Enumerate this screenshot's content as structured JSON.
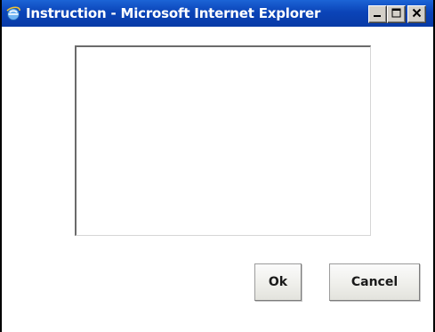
{
  "window": {
    "title": "Instruction - Microsoft Internet Explorer",
    "app_icon": "ie-icon",
    "controls": [
      "minimize-icon",
      "maximize-icon",
      "close-icon"
    ],
    "titlebar_color": "#0b44b8"
  },
  "form": {
    "instruction_text": "",
    "ok_label": "Ok",
    "cancel_label": "Cancel"
  }
}
